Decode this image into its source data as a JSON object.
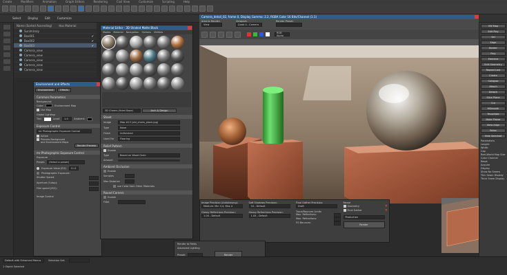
{
  "menubar": {
    "items": [
      "Create",
      "Modifiers",
      "Animation",
      "Graph Editors",
      "Rendering",
      "Civil View",
      "Customize",
      "Scripting",
      "Help"
    ]
  },
  "ribbon": {
    "tabs": [
      "Select",
      "Display",
      "Edit",
      "Customize"
    ]
  },
  "scene_explorer": {
    "header": {
      "col1": "Name (Sorted Ascending)",
      "col2": "Has Material"
    },
    "rows": [
      "Sunlmlrsky",
      "Box001",
      "Box002",
      "Box003",
      "Camera_view",
      "Camera_view",
      "Camera_view",
      "Camera_view",
      "Camera_view"
    ]
  },
  "environment": {
    "title": "Environment and Effects",
    "tabs": [
      "Environment",
      "Effects"
    ],
    "common_parameters": "Common Parameters",
    "background": "Background:",
    "color": "Color:",
    "environment_map": "Environment Map",
    "use_map": "Use Map",
    "global_lighting": "Global Lighting:",
    "tint": "Tint:",
    "level": "Level:",
    "level_value": "1.0",
    "ambient": "Ambient:",
    "exposure_control": "Exposure Control",
    "exposure_option": "mr Photographic Exposure Control",
    "active": "Active",
    "process_bg": "Process Background",
    "and_env_maps": "and Environment Maps",
    "render_preview": "Render Preview",
    "mr_exposure_control": "mr Photographic Exposure Control",
    "exposure": "Exposure",
    "preset": "Preset:",
    "preset_value": "(Select a preset)",
    "ev": "Exposure Value (EV):",
    "ev_value": "11.0",
    "photographic": "Photographic Exposure:",
    "shutter": "Shutter Speed:",
    "aperture": "Aperture (f-stop):",
    "film_iso": "Film speed (ISO):",
    "image_control": "Image Control"
  },
  "material_editor": {
    "title": "Material Editor - 3D Shaded Matte Black",
    "menu": [
      "Modes",
      "Material",
      "Navigation",
      "Options",
      "Utilities"
    ],
    "sample_colors": [
      "#8a7a66",
      "#5f5f5f",
      "#a9a9a9",
      "#6c6c6c",
      "#7a7a7a",
      "#b07040",
      "#6a6a6a",
      "#8c8c8c",
      "#9b6a40",
      "#4c7a86",
      "#777777",
      "#555555",
      "#6f6f6f",
      "#858585",
      "#939393",
      "#5a5a5a",
      "#7e7e7e",
      "#6a6a6a",
      "#8a8a8a",
      "#555555",
      "#9a9a9a",
      "#767676",
      "#6a6a6a",
      "#8e8e8e"
    ],
    "material_name": "3D Cheers (Hdmi Base)",
    "map_type": "Arch & Design",
    "rollout_sheet": "Sheet",
    "image": "Image",
    "image_value": "Map #13 (old_chairs_plank.jpg)",
    "type": "Type",
    "type_value": "None",
    "finish": "Finish",
    "finish_value": "Unfinished",
    "used_for": "Used For",
    "used_for_value": "Flooring",
    "relief_pattern": "Relief Pattern",
    "enable": "Enable",
    "type2_value": "Based on Wood Grain",
    "amount": "Amount",
    "ambient_occlusion": "Ambient Occlusion",
    "enable2": "Enable",
    "samples": "Samples",
    "max_distance": "Max Distance",
    "use_color": "use Color from Other Materials",
    "round_corners": "Round Corners",
    "enable3": "Enable",
    "fillet": "Fillet"
  },
  "viewport": {
    "title": "Camera_detail_02, frame 0, Display Gamma: 2.2, RGBA Color 16 Bits/Channel (1:1)",
    "area_to_render": "Area to Render:",
    "area_value": "View",
    "viewport_label": "Viewport:",
    "viewport_value": "Quad 4 - Camera",
    "render_preset": "Render Preset:",
    "render_preset_value": "",
    "channel": "RGB Alpha"
  },
  "render_settings": {
    "image_precision": "Image Precision (Antialiasing):",
    "image_precision_value": "Medium: Min 1/4, Max 4",
    "soft_shadows": "Soft Shadows Precision:",
    "soft_shadows_value": "1X - Default",
    "final_gather": "Final Gather Precision:",
    "final_gather_value": "Draft",
    "glossy_reflections": "Glossy Reflections Precision:",
    "glossy_reflections_value": "1.0X - Default",
    "glossy_refractions": "Glossy Refractions Precision:",
    "glossy_refractions_value": "1.0X - Default",
    "trace_bounce": "Trace/Bounces Limits",
    "max_reflections": "Max. Reflections:",
    "max_refractions": "Max. Refractions:",
    "fg_bounces": "FG Bounces:",
    "reuse": "Reuse",
    "geometry": "Geometry",
    "final_gather2": "Final Gather",
    "production": "Production",
    "render_button": "Render"
  },
  "render_setup_bottom": {
    "render_to_fields": "Render to Fields",
    "advanced_lighting": "Advanced Lighting",
    "preset": "Preset:",
    "view": "View:",
    "view_value": "Quad 4 - Camera",
    "render_button": "Render"
  },
  "right_panel": {
    "items": [
      "VW Map",
      "Edit Poly",
      "Sel",
      "Edge",
      "Border",
      "Poly",
      "Element",
      "Edit Geometry",
      "Repeat Last",
      "Create",
      "Collapse",
      "Attach",
      "Detach",
      "Slice Plane",
      "Cut",
      "MSmooth",
      "Tessellate",
      "Make Planar",
      "View Align",
      "Relax",
      "Hide Selected"
    ],
    "parameters": "Parameters",
    "length": "Length:",
    "width": "Width:",
    "cap": "Cap",
    "real_world": "Real-World Map Size",
    "color_channel": "Color Channel",
    "reset": "Reset",
    "acquire": "Acquire",
    "display": "Display",
    "show_no_seams": "Show No Seams",
    "thin_seam": "Thin Seam Display",
    "thick_seam": "Thick Seam Display"
  },
  "status": {
    "default_label": "Default with Enhanced Menus",
    "selection_set": "Selection Set:",
    "objects_selected": "1 Object Selected"
  }
}
